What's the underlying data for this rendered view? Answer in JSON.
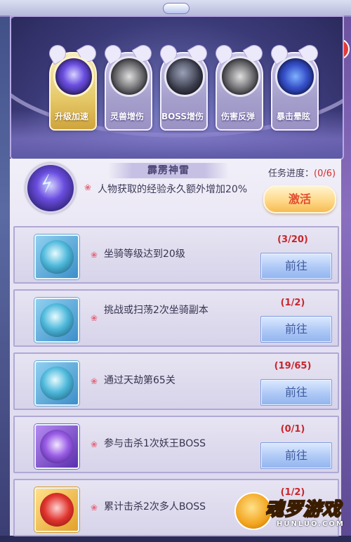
{
  "corner_badge": "⚡",
  "skills": [
    {
      "label": "升级加速",
      "active": true
    },
    {
      "label": "灵兽增伤",
      "active": false
    },
    {
      "label": "BOSS增伤",
      "active": false
    },
    {
      "label": "伤害反弹",
      "active": false
    },
    {
      "label": "暴击晕眩",
      "active": false
    }
  ],
  "detail": {
    "title": "霹雳神雷",
    "description": "人物获取的经验永久额外增加20%",
    "progress_label": "任务进度：",
    "progress_value": "(0/6)",
    "activate_label": "激活"
  },
  "tasks": [
    {
      "text": "坐骑等级达到20级",
      "count": "(3/20)",
      "button": "前往",
      "icon": "blue"
    },
    {
      "text": "挑战或扫荡2次坐骑副本",
      "count": "(1/2)",
      "button": "前往",
      "icon": "blue"
    },
    {
      "text": "通过天劫第65关",
      "count": "(19/65)",
      "button": "前往",
      "icon": "blue"
    },
    {
      "text": "参与击杀1次妖王BOSS",
      "count": "(0/1)",
      "button": "前往",
      "icon": "purple"
    },
    {
      "text": "累计击杀2次多人BOSS",
      "count": "(1/2)",
      "button": "",
      "icon": "gold"
    }
  ],
  "watermark": {
    "title": "魂罗游戏",
    "sub": "HUNLUO.COM"
  }
}
